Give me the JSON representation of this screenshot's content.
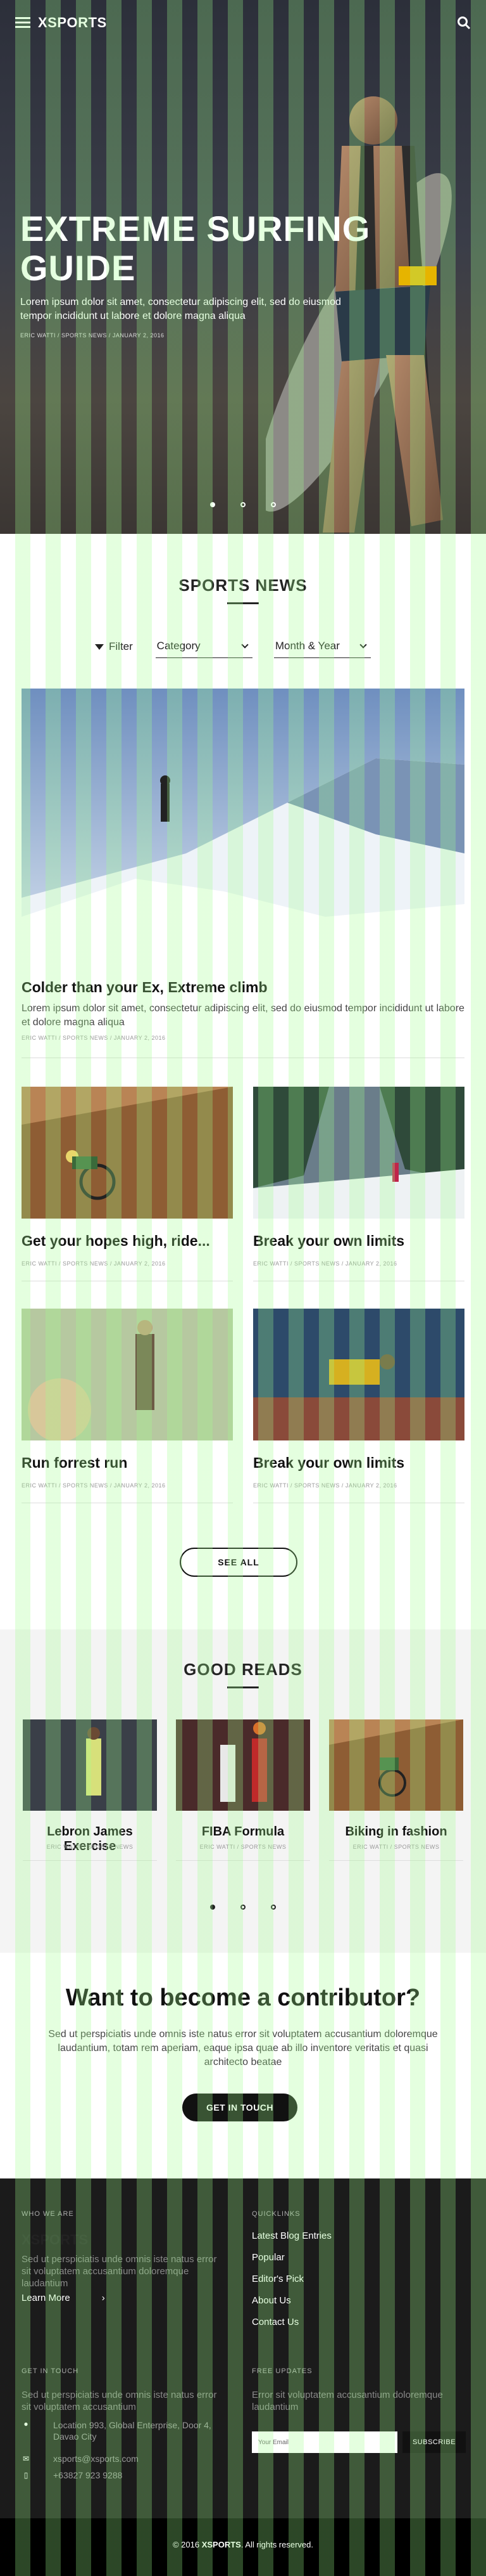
{
  "header": {
    "brand": "XSPORTS",
    "menu_icon": "hamburger-menu-icon",
    "search_icon": "search-icon"
  },
  "hero": {
    "title": "EXTREME SURFING GUIDE",
    "description": "Lorem ipsum dolor sit amet, consectetur adipiscing elit, sed do eiusmod tempor incididunt ut labore et dolore magna aliqua",
    "meta": "ERIC WATTI / SPORTS NEWS / JANUARY 2, 2016"
  },
  "sports_news": {
    "title": "SPORTS NEWS",
    "filter_label": "Filter",
    "category_value": "Category",
    "date_value": "Month & Year",
    "featured": {
      "title": "Colder than your Ex, Extreme climb",
      "description": "Lorem ipsum dolor sit amet, consectetur adipiscing elit, sed do eiusmod tempor incididunt ut labore et dolore magna aliqua",
      "meta": "ERIC WATTI / SPORTS NEWS / JANUARY 2, 2016"
    },
    "cards": [
      {
        "title": "Get your hopes high, ride...",
        "meta": "ERIC WATTI / SPORTS NEWS / JANUARY 2, 2016"
      },
      {
        "title": "Break your own limits",
        "meta": "ERIC WATTI / SPORTS NEWS / JANUARY 2, 2016"
      },
      {
        "title": "Run forrest run",
        "meta": "ERIC WATTI / SPORTS NEWS / JANUARY 2, 2016"
      },
      {
        "title": "Break your own limits",
        "meta": "ERIC WATTI / SPORTS NEWS / JANUARY 2, 2016"
      }
    ],
    "see_all": "SEE ALL"
  },
  "good_reads": {
    "title": "GOOD READS",
    "items": [
      {
        "title": "Lebron James Exercise",
        "meta": "ERIC WATTI / SPORTS NEWS"
      },
      {
        "title": "FIBA Formula",
        "meta": "ERIC WATTI / SPORTS NEWS"
      },
      {
        "title": "Biking in fashion",
        "meta": "ERIC WATTI / SPORTS NEWS"
      }
    ]
  },
  "contributor": {
    "title": "Want to become a contributor?",
    "description": "Sed ut perspiciatis unde omnis iste natus error sit voluptatem accusantium doloremque laudantium, totam rem aperiam, eaque ipsa quae ab illo inventore veritatis et quasi architecto beatae",
    "button": "GET IN TOUCH"
  },
  "footer": {
    "who_heading": "WHO WE ARE",
    "brand": "XSPORTS",
    "who_text": "Sed ut perspiciatis unde omnis iste natus error sit voluptatem accusantium doloremque laudantium",
    "learn_more": "Learn More",
    "quicklinks_heading": "QUICKLINKS",
    "quicklinks": [
      "Latest Blog Entries",
      "Popular",
      "Editor's Pick",
      "About Us",
      "Contact Us"
    ],
    "touch_heading": "GET IN TOUCH",
    "touch_text": "Sed ut perspiciatis unde omnis iste natus error sit voluptatem accusantium",
    "address": "Location 993, Global Enterprise, Door 4, Davao City",
    "email": "xsports@xsports.com",
    "phone": "+63827 923 9288",
    "updates_heading": "FREE UPDATES",
    "updates_text": "Error sit voluptatem accusantium doloremque laudantium",
    "email_placeholder": "Your Email",
    "subscribe": "SUBSCRIBE",
    "copyright_prefix": "© 2016 ",
    "copyright_brand": "XSPORTS",
    "copyright_suffix": ". All rights reserved."
  }
}
